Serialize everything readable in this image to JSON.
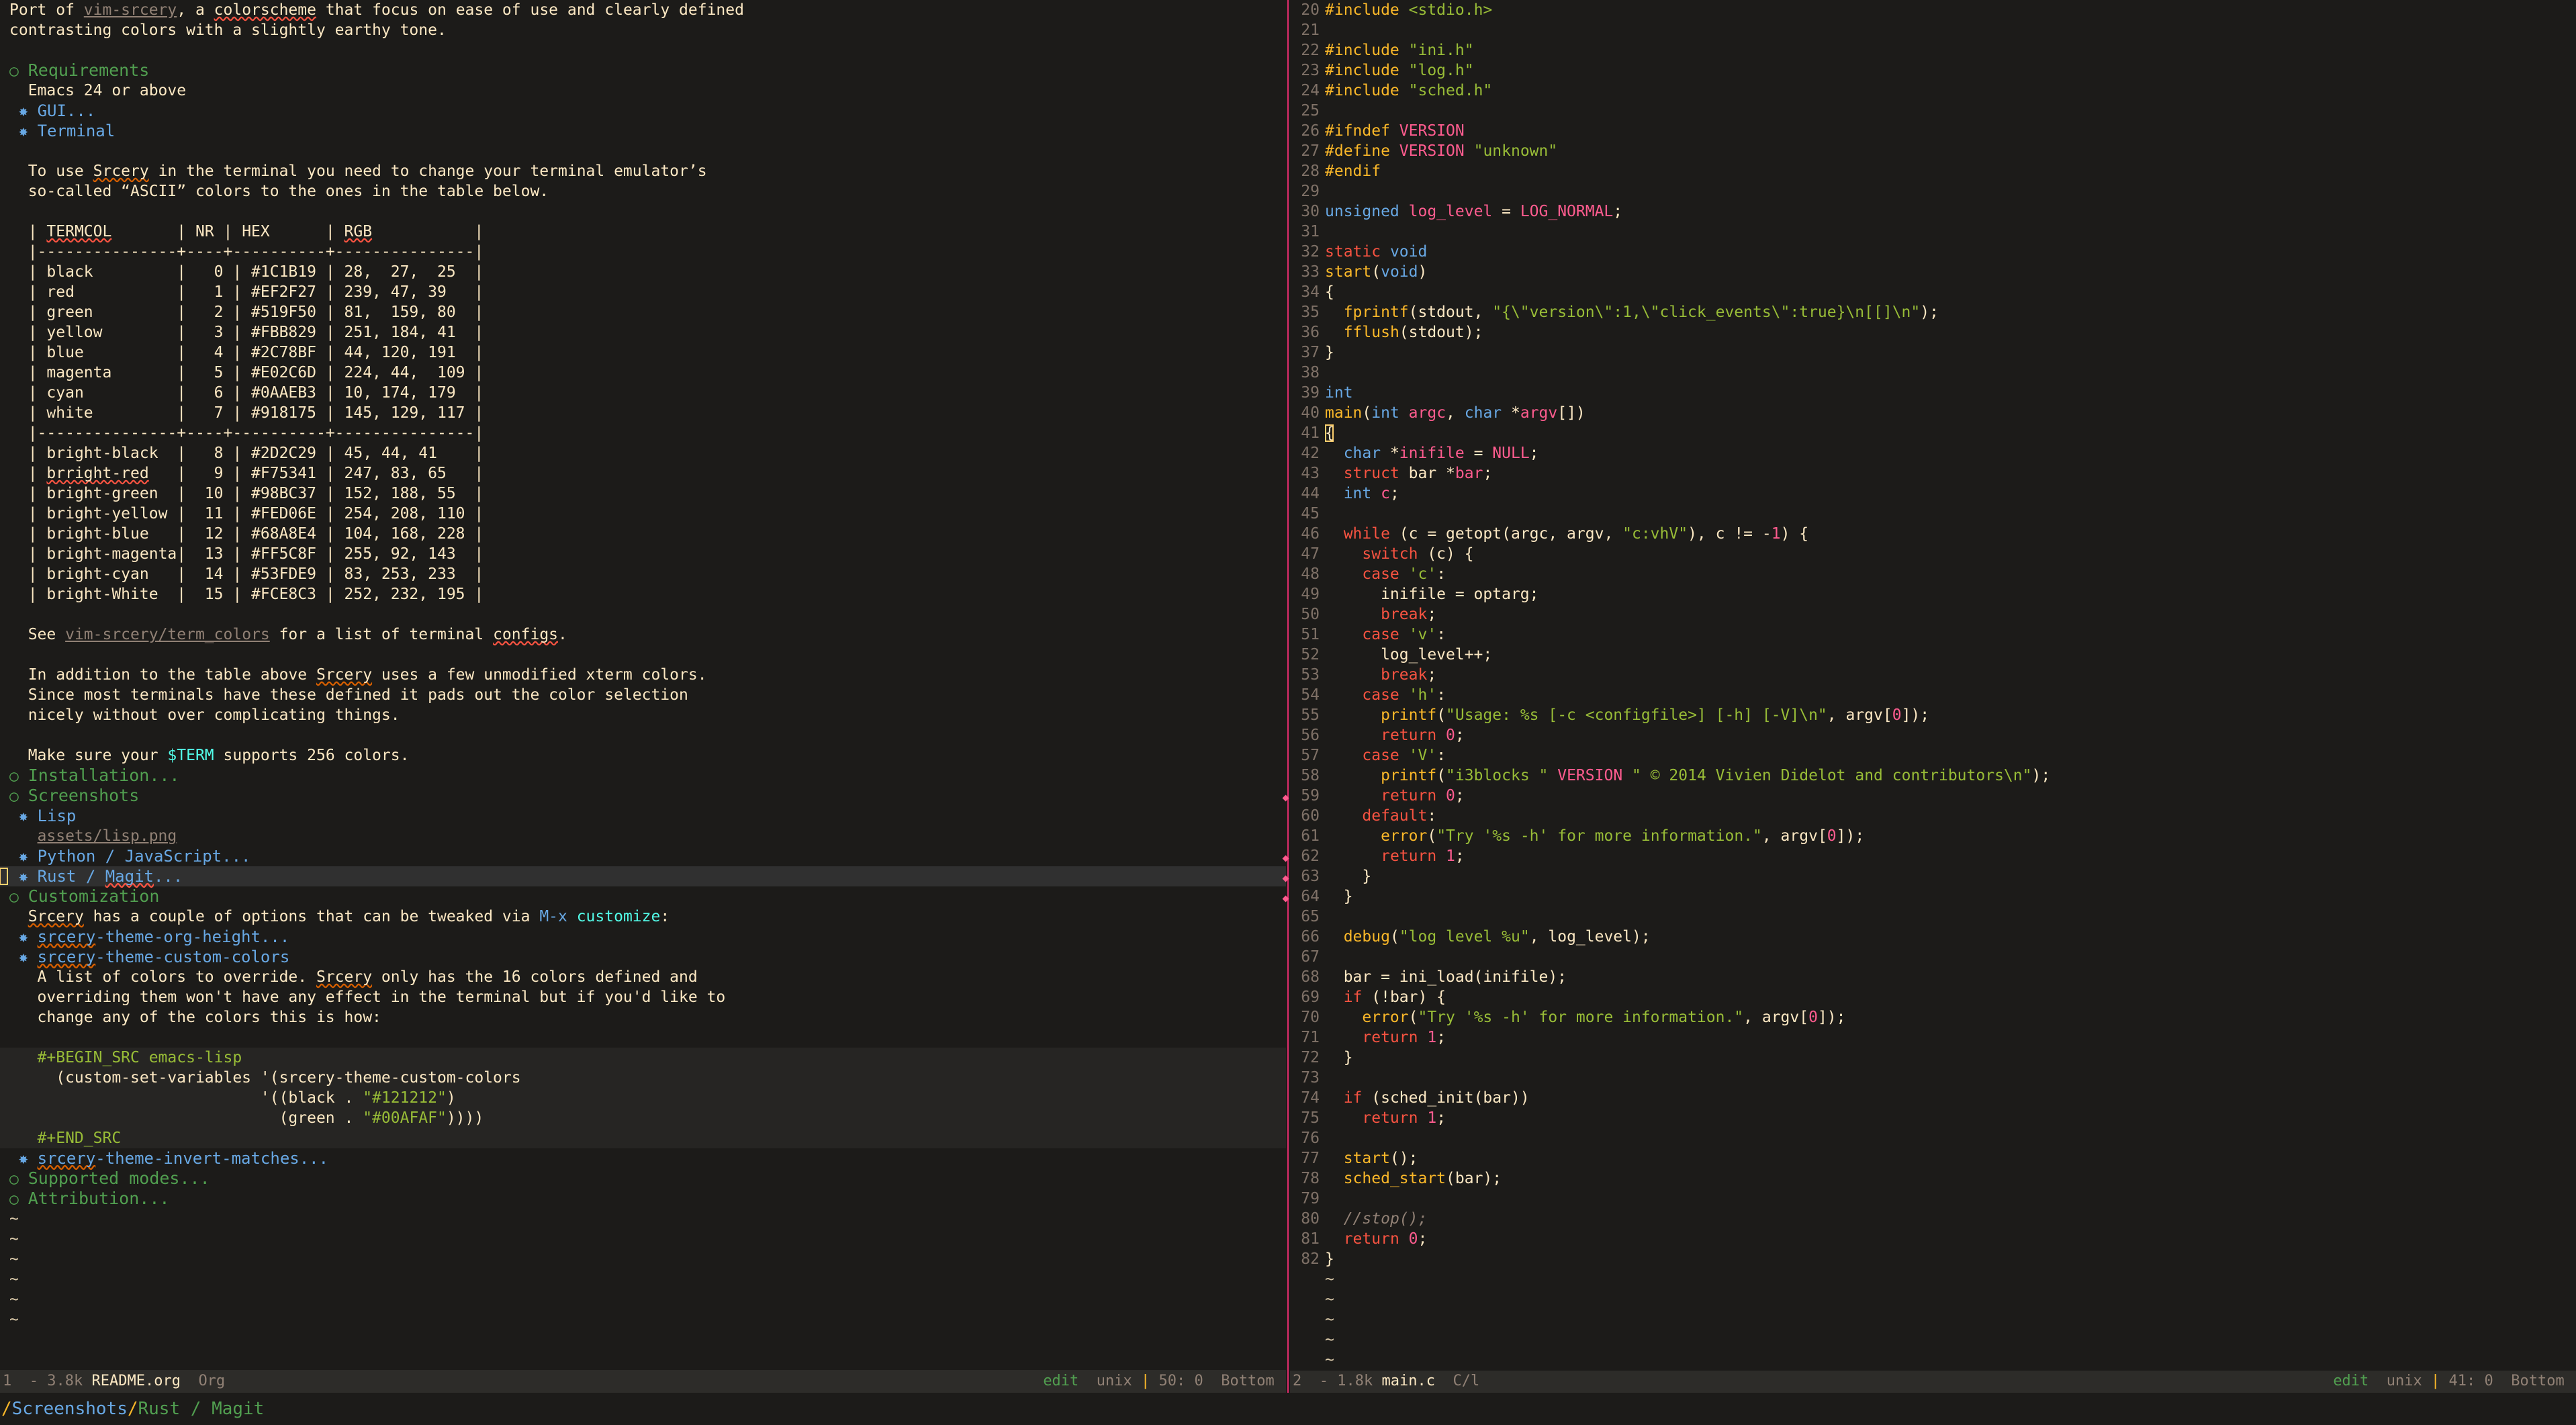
{
  "app": "emacs",
  "left": {
    "buffer_name": "README.org",
    "major_mode": "Org",
    "size": "3.8k",
    "window_number": "1",
    "modified_flag": "-",
    "encoding": "unix",
    "line_col": "50: 0",
    "position": "Bottom",
    "edit_state": "edit",
    "intro": [
      "Port of vim-srcery, a colorscheme that focus on ease of use and clearly defined",
      "contrasting colors with a slightly earthy tone."
    ],
    "intro_link": "vim-srcery",
    "headings": {
      "requirements": "Requirements",
      "installation": "Installation...",
      "screenshots": "Screenshots",
      "customization": "Customization",
      "supported_modes": "Supported modes...",
      "attribution": "Attribution..."
    },
    "requirements_note": "Emacs 24 or above",
    "requirements_items": [
      "GUI...",
      "Terminal"
    ],
    "terminal_note": [
      "To use Srcery in the terminal you need to change your terminal emulator's",
      "so-called “ASCII” colors to the ones in the table below."
    ],
    "table": {
      "headers": [
        "TERMCOL",
        "NR",
        "HEX",
        "RGB"
      ],
      "rows": [
        [
          "black",
          "0",
          "#1C1B19",
          "28,  27,  25"
        ],
        [
          "red",
          "1",
          "#EF2F27",
          "239, 47, 39"
        ],
        [
          "green",
          "2",
          "#519F50",
          "81,  159, 80"
        ],
        [
          "yellow",
          "3",
          "#FBB829",
          "251, 184, 41"
        ],
        [
          "blue",
          "4",
          "#2C78BF",
          "44, 120, 191"
        ],
        [
          "magenta",
          "5",
          "#E02C6D",
          "224, 44,  109"
        ],
        [
          "cyan",
          "6",
          "#0AAEB3",
          "10, 174, 179"
        ],
        [
          "white",
          "7",
          "#918175",
          "145, 129, 117"
        ],
        [
          "bright-black",
          "8",
          "#2D2C29",
          "45, 44, 41"
        ],
        [
          "brright-red",
          "9",
          "#F75341",
          "247, 83, 65"
        ],
        [
          "bright-green",
          "10",
          "#98BC37",
          "152, 188, 55"
        ],
        [
          "bright-yellow",
          "11",
          "#FED06E",
          "254, 208, 110"
        ],
        [
          "bright-blue",
          "12",
          "#68A8E4",
          "104, 168, 228"
        ],
        [
          "bright-magenta",
          "13",
          "#FF5C8F",
          "255, 92, 143"
        ],
        [
          "bright-cyan",
          "14",
          "#53FDE9",
          "83, 253, 233"
        ],
        [
          "bright-White",
          "15",
          "#FCE8C3",
          "252, 232, 195"
        ]
      ]
    },
    "see_line_pre": "See ",
    "see_link": "vim-srcery/term_colors",
    "see_line_post": " for a list of terminal configs.",
    "xterm_note": [
      "In addition to the table above Srcery uses a few unmodified xterm colors.",
      "Since most terminals have these defined it pads out the color selection",
      "nicely without over complicating things."
    ],
    "term_note_pre": "Make sure your ",
    "term_var": "$TERM",
    "term_note_post": " supports 256 colors.",
    "screenshot_items": [
      "Lisp",
      "Python / JavaScript...",
      "Rust / Magit..."
    ],
    "screenshot_asset": "assets/lisp.png",
    "custom_note_pre": "Srcery has a couple of options that can be tweaked via ",
    "custom_note_kbd": "M-x",
    "custom_note_cmd": " customize",
    "custom_note_post": ":",
    "custom_items": [
      "srcery-theme-org-height...",
      "srcery-theme-custom-colors",
      "srcery-theme-invert-matches..."
    ],
    "custom_colors_desc": [
      "A list of colors to override. Srcery only has the 16 colors defined and",
      "overriding them won't have any effect in the terminal but if you'd like to",
      "change any of the colors this is how:"
    ],
    "src_begin": "#+BEGIN_SRC emacs-lisp",
    "src_end": "#+END_SRC",
    "src_lines": [
      "  (custom-set-variables '(srcery-theme-custom-colors",
      "                        '((black . \"#121212\")",
      "                          (green . \"#00AFAF\"))))"
    ],
    "tilde": "~"
  },
  "right": {
    "buffer_name": "main.c",
    "major_mode": "C/l",
    "size": "1.8k",
    "window_number": "2",
    "modified_flag": "-",
    "encoding": "unix",
    "line_col": "41: 0",
    "position": "Bottom",
    "edit_state": "edit",
    "tilde": "~",
    "first_line_number": 20,
    "code": [
      {
        "n": 20,
        "t": "#include <stdio.h>"
      },
      {
        "n": 21,
        "t": ""
      },
      {
        "n": 22,
        "t": "#include \"ini.h\""
      },
      {
        "n": 23,
        "t": "#include \"log.h\""
      },
      {
        "n": 24,
        "t": "#include \"sched.h\""
      },
      {
        "n": 25,
        "t": ""
      },
      {
        "n": 26,
        "t": "#ifndef VERSION"
      },
      {
        "n": 27,
        "t": "#define VERSION \"unknown\""
      },
      {
        "n": 28,
        "t": "#endif"
      },
      {
        "n": 29,
        "t": ""
      },
      {
        "n": 30,
        "t": "unsigned log_level = LOG_NORMAL;"
      },
      {
        "n": 31,
        "t": ""
      },
      {
        "n": 32,
        "t": "static void"
      },
      {
        "n": 33,
        "t": "start(void)"
      },
      {
        "n": 34,
        "t": "{"
      },
      {
        "n": 35,
        "t": "  fprintf(stdout, \"{\\\"version\\\":1,\\\"click_events\\\":true}\\n[[]\\n\");"
      },
      {
        "n": 36,
        "t": "  fflush(stdout);"
      },
      {
        "n": 37,
        "t": "}"
      },
      {
        "n": 38,
        "t": ""
      },
      {
        "n": 39,
        "t": "int"
      },
      {
        "n": 40,
        "t": "main(int argc, char *argv[])"
      },
      {
        "n": 41,
        "t": "{"
      },
      {
        "n": 42,
        "t": "  char *inifile = NULL;"
      },
      {
        "n": 43,
        "t": "  struct bar *bar;"
      },
      {
        "n": 44,
        "t": "  int c;"
      },
      {
        "n": 45,
        "t": ""
      },
      {
        "n": 46,
        "t": "  while (c = getopt(argc, argv, \"c:vhV\"), c != -1) {"
      },
      {
        "n": 47,
        "t": "    switch (c) {"
      },
      {
        "n": 48,
        "t": "    case 'c':"
      },
      {
        "n": 49,
        "t": "      inifile = optarg;"
      },
      {
        "n": 50,
        "t": "      break;"
      },
      {
        "n": 51,
        "t": "    case 'v':"
      },
      {
        "n": 52,
        "t": "      log_level++;"
      },
      {
        "n": 53,
        "t": "      break;"
      },
      {
        "n": 54,
        "t": "    case 'h':"
      },
      {
        "n": 55,
        "t": "      printf(\"Usage: %s [-c <configfile>] [-h] [-V]\\n\", argv[0]);"
      },
      {
        "n": 56,
        "t": "      return 0;"
      },
      {
        "n": 57,
        "t": "    case 'V':"
      },
      {
        "n": 58,
        "t": "      printf(\"i3blocks \" VERSION \" © 2014 Vivien Didelot and contributors\\n\");"
      },
      {
        "n": 59,
        "t": "      return 0;"
      },
      {
        "n": 60,
        "t": "    default:"
      },
      {
        "n": 61,
        "t": "      error(\"Try '%s -h' for more information.\", argv[0]);"
      },
      {
        "n": 62,
        "t": "      return 1;"
      },
      {
        "n": 63,
        "t": "    }"
      },
      {
        "n": 64,
        "t": "  }"
      },
      {
        "n": 65,
        "t": ""
      },
      {
        "n": 66,
        "t": "  debug(\"log level %u\", log_level);"
      },
      {
        "n": 67,
        "t": ""
      },
      {
        "n": 68,
        "t": "  bar = ini_load(inifile);"
      },
      {
        "n": 69,
        "t": "  if (!bar) {"
      },
      {
        "n": 70,
        "t": "    error(\"Try '%s -h' for more information.\", argv[0]);"
      },
      {
        "n": 71,
        "t": "    return 1;"
      },
      {
        "n": 72,
        "t": "  }"
      },
      {
        "n": 73,
        "t": ""
      },
      {
        "n": 74,
        "t": "  if (sched_init(bar))"
      },
      {
        "n": 75,
        "t": "    return 1;"
      },
      {
        "n": 76,
        "t": ""
      },
      {
        "n": 77,
        "t": "  start();"
      },
      {
        "n": 78,
        "t": "  sched_start(bar);"
      },
      {
        "n": 79,
        "t": ""
      },
      {
        "n": 80,
        "t": "  //stop();"
      },
      {
        "n": 81,
        "t": "  return 0;"
      },
      {
        "n": 82,
        "t": "}"
      }
    ]
  },
  "echo": {
    "sep1": "/",
    "part1": "Screenshots",
    "sep2": "/",
    "part2": "Rust / Magit"
  },
  "colors": {
    "background": "#1C1B19",
    "foreground": "#FCE8C3",
    "modeline": "#2D2C29",
    "green": "#519F50",
    "blue": "#68A8E4",
    "magenta": "#E02C6D",
    "yellow": "#FBB829"
  }
}
